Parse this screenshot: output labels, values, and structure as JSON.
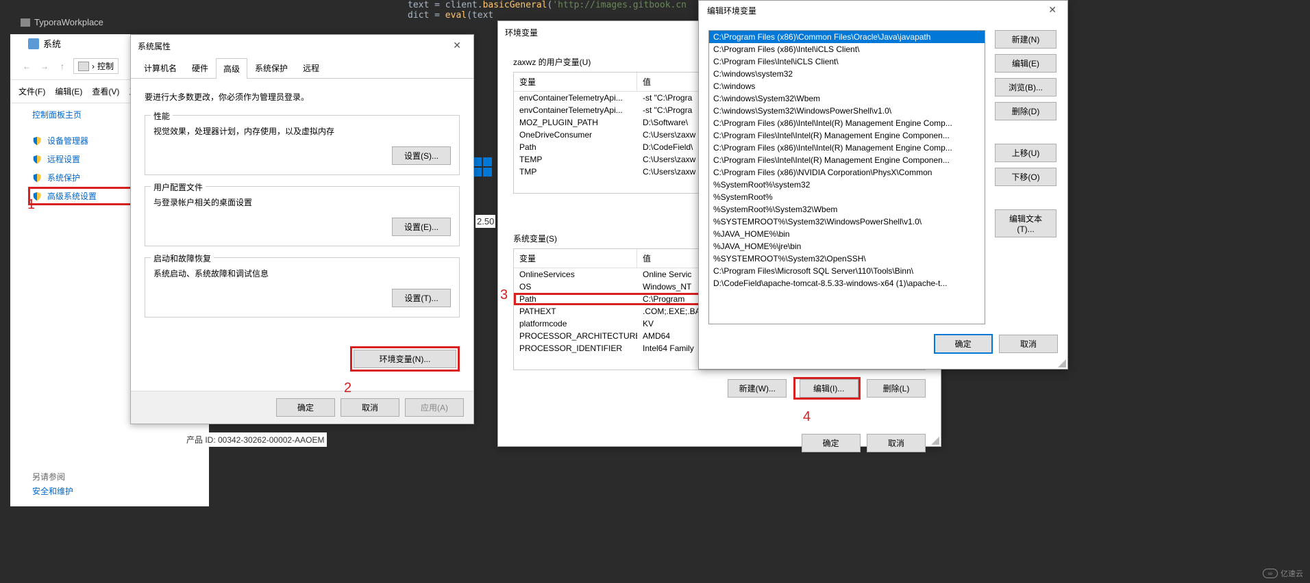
{
  "editor": {
    "title": "TyporaWorkplace",
    "line1_pre": "text = client.",
    "line1_fn": "basicGeneral",
    "line1_str": "'http://images.gitbook.cn",
    "line2_pre": "dict = ",
    "line2_fn": "eval",
    "line2_arg": "(text"
  },
  "cp": {
    "title": "系统",
    "crumb": "控制",
    "menu_file": "文件(F)",
    "menu_edit": "编辑(E)",
    "menu_view": "查看(V)",
    "menu_t": "工",
    "home": "控制面板主页",
    "link_devmgr": "设备管理器",
    "link_remote": "远程设置",
    "link_protect": "系统保护",
    "link_adv": "高级系统设置",
    "see_also": "另请参阅",
    "sec_maint": "安全和维护"
  },
  "annot": {
    "a1": "1",
    "a2": "2",
    "a3": "3",
    "a4": "4"
  },
  "sp": {
    "title": "系统属性",
    "tab_computer": "计算机名",
    "tab_hardware": "硬件",
    "tab_advanced": "高级",
    "tab_protect": "系统保护",
    "tab_remote": "远程",
    "admin_msg": "要进行大多数更改，你必须作为管理员登录。",
    "perf_label": "性能",
    "perf_desc": "视觉效果，处理器计划，内存使用，以及虚拟内存",
    "perf_btn": "设置(S)...",
    "profile_label": "用户配置文件",
    "profile_desc": "与登录帐户相关的桌面设置",
    "profile_btn": "设置(E)...",
    "startup_label": "启动和故障恢复",
    "startup_desc": "系统启动、系统故障和调试信息",
    "startup_btn": "设置(T)...",
    "env_btn": "环境变量(N)...",
    "ok": "确定",
    "cancel": "取消",
    "apply": "应用(A)",
    "product_id": "产品 ID: 00342-30262-00002-AAOEM"
  },
  "val_250": "2.50",
  "env": {
    "title": "环境变量",
    "user_label": "zaxwz 的用户变量(U)",
    "hdr_var": "变量",
    "hdr_val": "值",
    "user_rows": [
      {
        "v": "envContainerTelemetryApi...",
        "val": "-st \"C:\\Progra"
      },
      {
        "v": "envContainerTelemetryApi...",
        "val": "-st \"C:\\Progra"
      },
      {
        "v": "MOZ_PLUGIN_PATH",
        "val": "D:\\Software\\"
      },
      {
        "v": "OneDriveConsumer",
        "val": "C:\\Users\\zaxw"
      },
      {
        "v": "Path",
        "val": "D:\\CodeField\\"
      },
      {
        "v": "TEMP",
        "val": "C:\\Users\\zaxw"
      },
      {
        "v": "TMP",
        "val": "C:\\Users\\zaxw"
      }
    ],
    "sys_label": "系统变量(S)",
    "sys_rows": [
      {
        "v": "OnlineServices",
        "val": "Online Servic"
      },
      {
        "v": "OS",
        "val": "Windows_NT"
      },
      {
        "v": "Path",
        "val": "C:\\Program"
      },
      {
        "v": "PATHEXT",
        "val": ".COM;.EXE;.BA"
      },
      {
        "v": "platformcode",
        "val": "KV"
      },
      {
        "v": "PROCESSOR_ARCHITECTURE",
        "val": "AMD64"
      },
      {
        "v": "PROCESSOR_IDENTIFIER",
        "val": "Intel64 Family"
      }
    ],
    "btn_new": "新建(W)...",
    "btn_edit": "编辑(I)...",
    "btn_del": "删除(L)",
    "ok": "确定",
    "cancel": "取消"
  },
  "edit": {
    "title": "编辑环境变量",
    "items": [
      "C:\\Program Files (x86)\\Common Files\\Oracle\\Java\\javapath",
      "C:\\Program Files (x86)\\Intel\\iCLS Client\\",
      "C:\\Program Files\\Intel\\iCLS Client\\",
      "C:\\windows\\system32",
      "C:\\windows",
      "C:\\windows\\System32\\Wbem",
      "C:\\windows\\System32\\WindowsPowerShell\\v1.0\\",
      "C:\\Program Files (x86)\\Intel\\Intel(R) Management Engine Comp...",
      "C:\\Program Files\\Intel\\Intel(R) Management Engine Componen...",
      "C:\\Program Files (x86)\\Intel\\Intel(R) Management Engine Comp...",
      "C:\\Program Files\\Intel\\Intel(R) Management Engine Componen...",
      "C:\\Program Files (x86)\\NVIDIA Corporation\\PhysX\\Common",
      "%SystemRoot%\\system32",
      "%SystemRoot%",
      "%SystemRoot%\\System32\\Wbem",
      "%SYSTEMROOT%\\System32\\WindowsPowerShell\\v1.0\\",
      "%JAVA_HOME%\\bin",
      "%JAVA_HOME%\\jre\\bin",
      "%SYSTEMROOT%\\System32\\OpenSSH\\",
      "C:\\Program Files\\Microsoft SQL Server\\110\\Tools\\Binn\\",
      "D:\\CodeField\\apache-tomcat-8.5.33-windows-x64 (1)\\apache-t..."
    ],
    "btn_new": "新建(N)",
    "btn_edit": "编辑(E)",
    "btn_browse": "浏览(B)...",
    "btn_del": "删除(D)",
    "btn_up": "上移(U)",
    "btn_down": "下移(O)",
    "btn_edittext": "编辑文本(T)...",
    "ok": "确定",
    "cancel": "取消"
  },
  "watermark": "亿速云"
}
